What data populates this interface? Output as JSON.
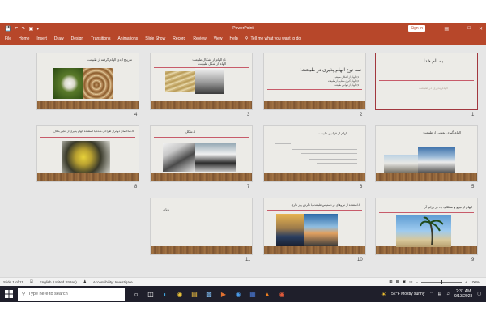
{
  "window": {
    "app_title": "PowerPoint",
    "sign_in": "Sign in"
  },
  "ribbon": {
    "tabs": [
      "File",
      "Home",
      "Insert",
      "Draw",
      "Design",
      "Transitions",
      "Animations",
      "Slide Show",
      "Record",
      "Review",
      "View",
      "Help"
    ],
    "tell_me": "Tell me what you want to do"
  },
  "slides": [
    {
      "num": "1",
      "title": "به نام خدا",
      "subtitle": "الهام پذیری در طبیعت"
    },
    {
      "num": "2",
      "title": "سه نوع الهام پذیری در طبیعت:",
      "bullets": [
        "1) الهام از اشکال طبیعی",
        "2) الهام گیری معنایی از طبیعت",
        "3) الهام از قوانین طبیعت"
      ]
    },
    {
      "num": "3",
      "title": "1) الهام از اشکال طبیعت:",
      "subtitle": "الهام از شکل طبیعت"
    },
    {
      "num": "4",
      "title": "مارپیچ ابدی الهام گرفته از طبیعت"
    },
    {
      "num": "5",
      "title": "الهام گیری معنایی از طبیعت:"
    },
    {
      "num": "6",
      "title": "الهام از قوانین طبیعت"
    },
    {
      "num": "7",
      "title": "4-شکل"
    },
    {
      "num": "8",
      "title": "5-ساختمان دو تراز طراحی شده با استفاده الهام پذیری از انجیر بنگال"
    },
    {
      "num": "9",
      "title": "الهام از نیرو و عملکرد باد در برابر آن"
    },
    {
      "num": "10",
      "title": "6-استفاده از نیروهای در دسترس طبیعت با نگرش ریز نگری"
    },
    {
      "num": "11",
      "title": "پایان"
    }
  ],
  "statusbar": {
    "slide_info": "Slide 1 of 11",
    "language": "English (United States)",
    "accessibility": "Accessibility: Investigate",
    "zoom": "100%"
  },
  "taskbar": {
    "search_placeholder": "Type here to search",
    "weather": "52°F  Mostly sunny",
    "time": "2:31 AM",
    "date": "9/13/2023"
  }
}
